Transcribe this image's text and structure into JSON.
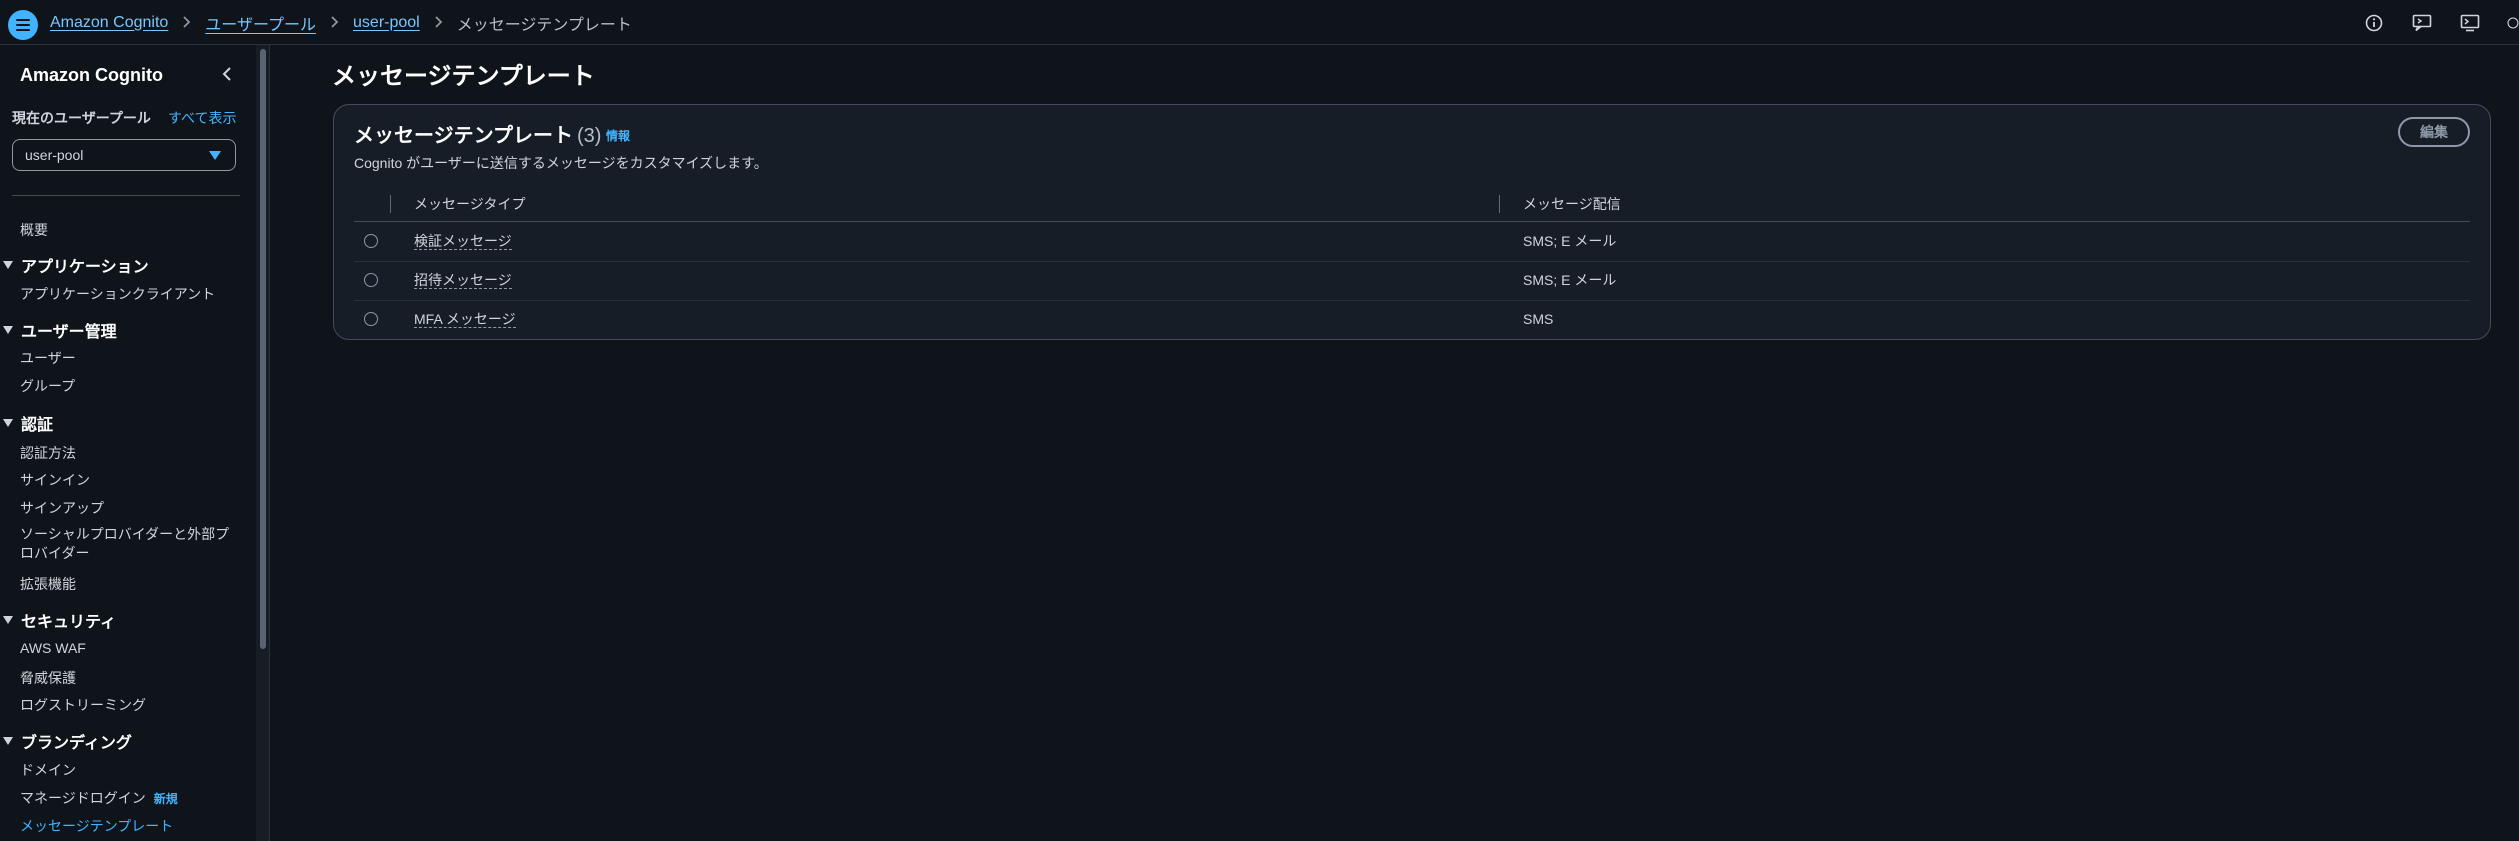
{
  "breadcrumb": {
    "items": [
      "Amazon Cognito",
      "ユーザープール",
      "user-pool"
    ],
    "current": "メッセージテンプレート"
  },
  "sidebar": {
    "title": "Amazon Cognito",
    "current_pool_label": "現在のユーザープール",
    "show_all": "すべて表示",
    "pool_select_value": "user-pool",
    "overview": "概要",
    "sections": {
      "applications": {
        "label": "アプリケーション",
        "items": [
          "アプリケーションクライアント"
        ]
      },
      "user_management": {
        "label": "ユーザー管理",
        "items": [
          "ユーザー",
          "グループ"
        ]
      },
      "auth": {
        "label": "認証",
        "items": [
          "認証方法",
          "サインイン",
          "サインアップ",
          "ソーシャルプロバイダーと外部プロバイダー",
          "拡張機能"
        ]
      },
      "security": {
        "label": "セキュリティ",
        "items": [
          "AWS WAF",
          "脅威保護",
          "ログストリーミング"
        ]
      },
      "branding": {
        "label": "ブランディング",
        "items": [
          "ドメイン",
          "マネージドログイン",
          "メッセージテンプレート"
        ],
        "new_badge": "新規"
      }
    }
  },
  "main": {
    "page_title": "メッセージテンプレート",
    "panel": {
      "title": "メッセージテンプレート",
      "count": "(3)",
      "info": "情報",
      "description": "Cognito がユーザーに送信するメッセージをカスタマイズします。",
      "edit_button": "編集",
      "columns": [
        "メッセージタイプ",
        "メッセージ配信"
      ],
      "rows": [
        {
          "type": "検証メッセージ",
          "delivery": "SMS; E メール"
        },
        {
          "type": "招待メッセージ",
          "delivery": "SMS; E メール"
        },
        {
          "type": "MFA メッセージ",
          "delivery": "SMS"
        }
      ]
    }
  },
  "colors": {
    "background": "#0f141a",
    "panel": "#161d26",
    "accent": "#42b4ff",
    "link": "#7ac6ff"
  },
  "icons": [
    "menu-icon",
    "info-icon",
    "feedback-icon",
    "cloudshell-icon",
    "chevron-left-icon",
    "chevron-right-icon",
    "caret-down-icon"
  ]
}
